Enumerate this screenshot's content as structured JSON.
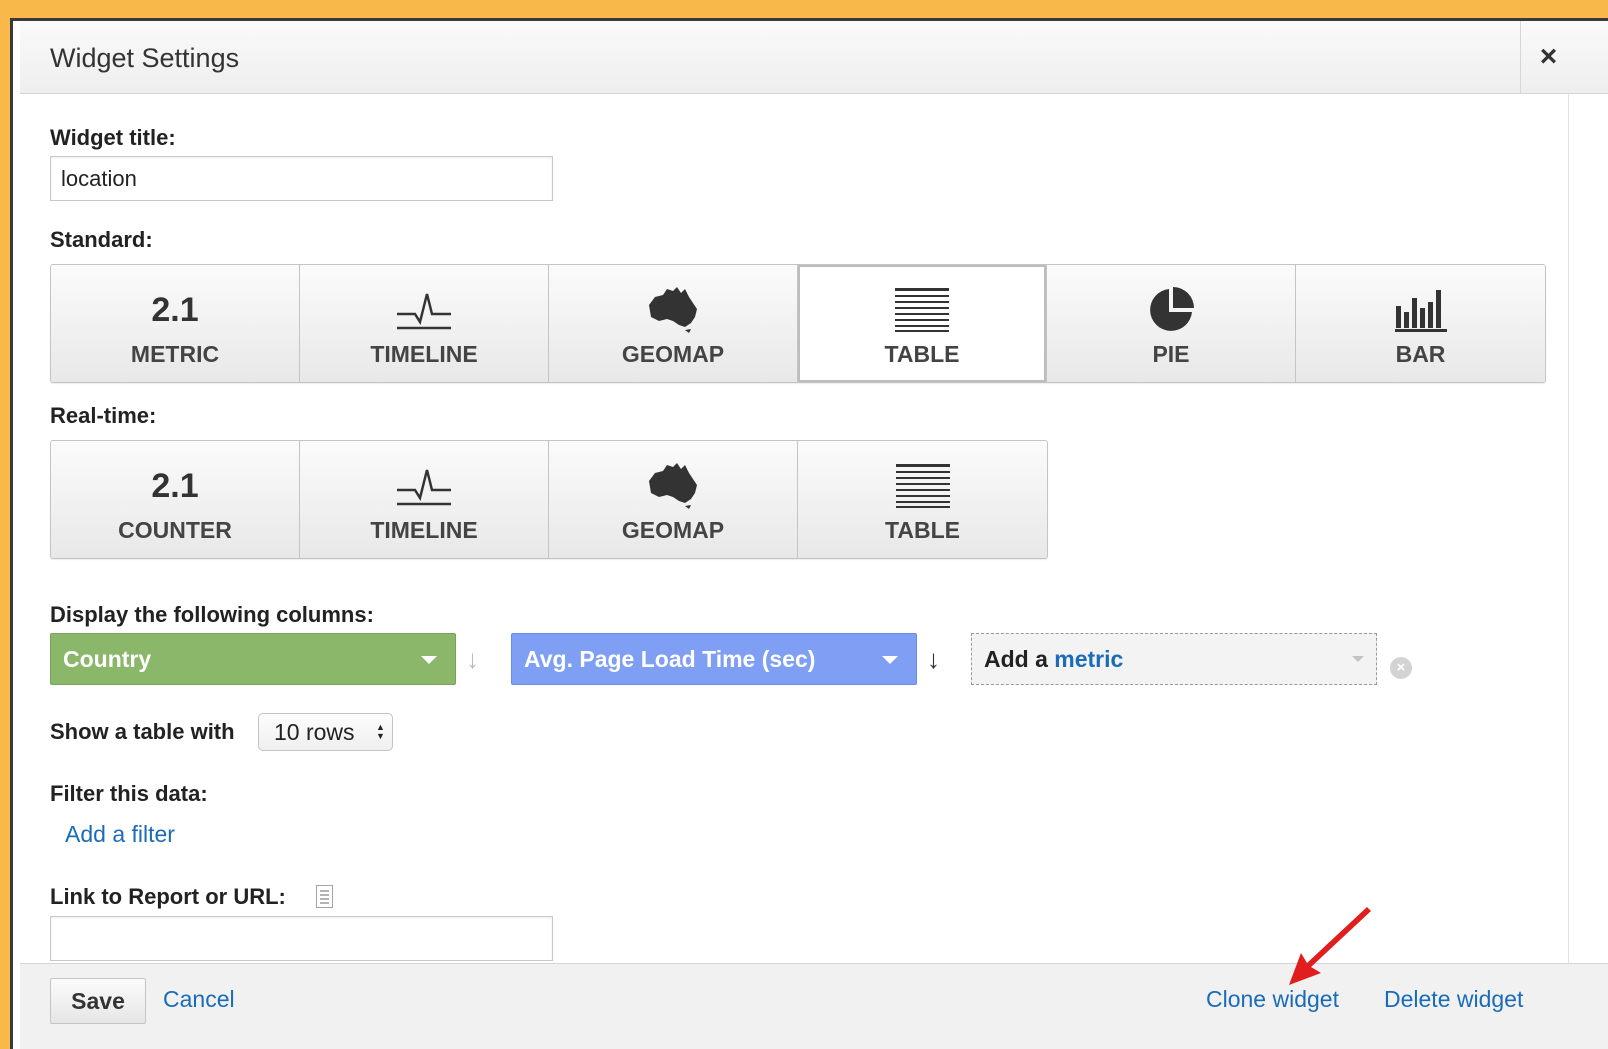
{
  "dialog": {
    "title": "Widget Settings",
    "close_symbol": "×"
  },
  "widget_title": {
    "label": "Widget title:",
    "value": "location"
  },
  "standard": {
    "label": "Standard:",
    "selected": "TABLE",
    "buttons": [
      {
        "label": "METRIC",
        "icon_text": "2.1",
        "icon": "metric-number-icon"
      },
      {
        "label": "TIMELINE",
        "icon": "timeline-icon"
      },
      {
        "label": "GEOMAP",
        "icon": "australia-map-icon"
      },
      {
        "label": "TABLE",
        "icon": "table-lines-icon"
      },
      {
        "label": "PIE",
        "icon": "pie-chart-icon"
      },
      {
        "label": "BAR",
        "icon": "bar-chart-icon"
      }
    ]
  },
  "realtime": {
    "label": "Real-time:",
    "buttons": [
      {
        "label": "COUNTER",
        "icon_text": "2.1",
        "icon": "counter-number-icon"
      },
      {
        "label": "TIMELINE",
        "icon": "timeline-icon"
      },
      {
        "label": "GEOMAP",
        "icon": "australia-map-icon"
      },
      {
        "label": "TABLE",
        "icon": "table-lines-icon"
      }
    ]
  },
  "columns": {
    "label": "Display the following columns:",
    "dimension": {
      "label": "Country",
      "color": "#8bb76a"
    },
    "metric": {
      "label": "Avg. Page Load Time (sec)",
      "color": "#7f9ff4"
    },
    "add_metric": {
      "prefix": "Add a",
      "link": "metric"
    },
    "sort_arrow": "↓",
    "remove_symbol": "×"
  },
  "rows": {
    "label": "Show a table with",
    "value": "10 rows",
    "stepper": "▲▼"
  },
  "filter": {
    "label": "Filter this data:",
    "add_link": "Add a filter"
  },
  "link_report": {
    "label": "Link to Report or URL:",
    "value": ""
  },
  "footer": {
    "save": "Save",
    "cancel": "Cancel",
    "clone": "Clone widget",
    "delete": "Delete widget"
  },
  "colors": {
    "frame": "#f8b94a",
    "link": "#1a6bb8",
    "annotation_arrow": "#e01e1e"
  }
}
